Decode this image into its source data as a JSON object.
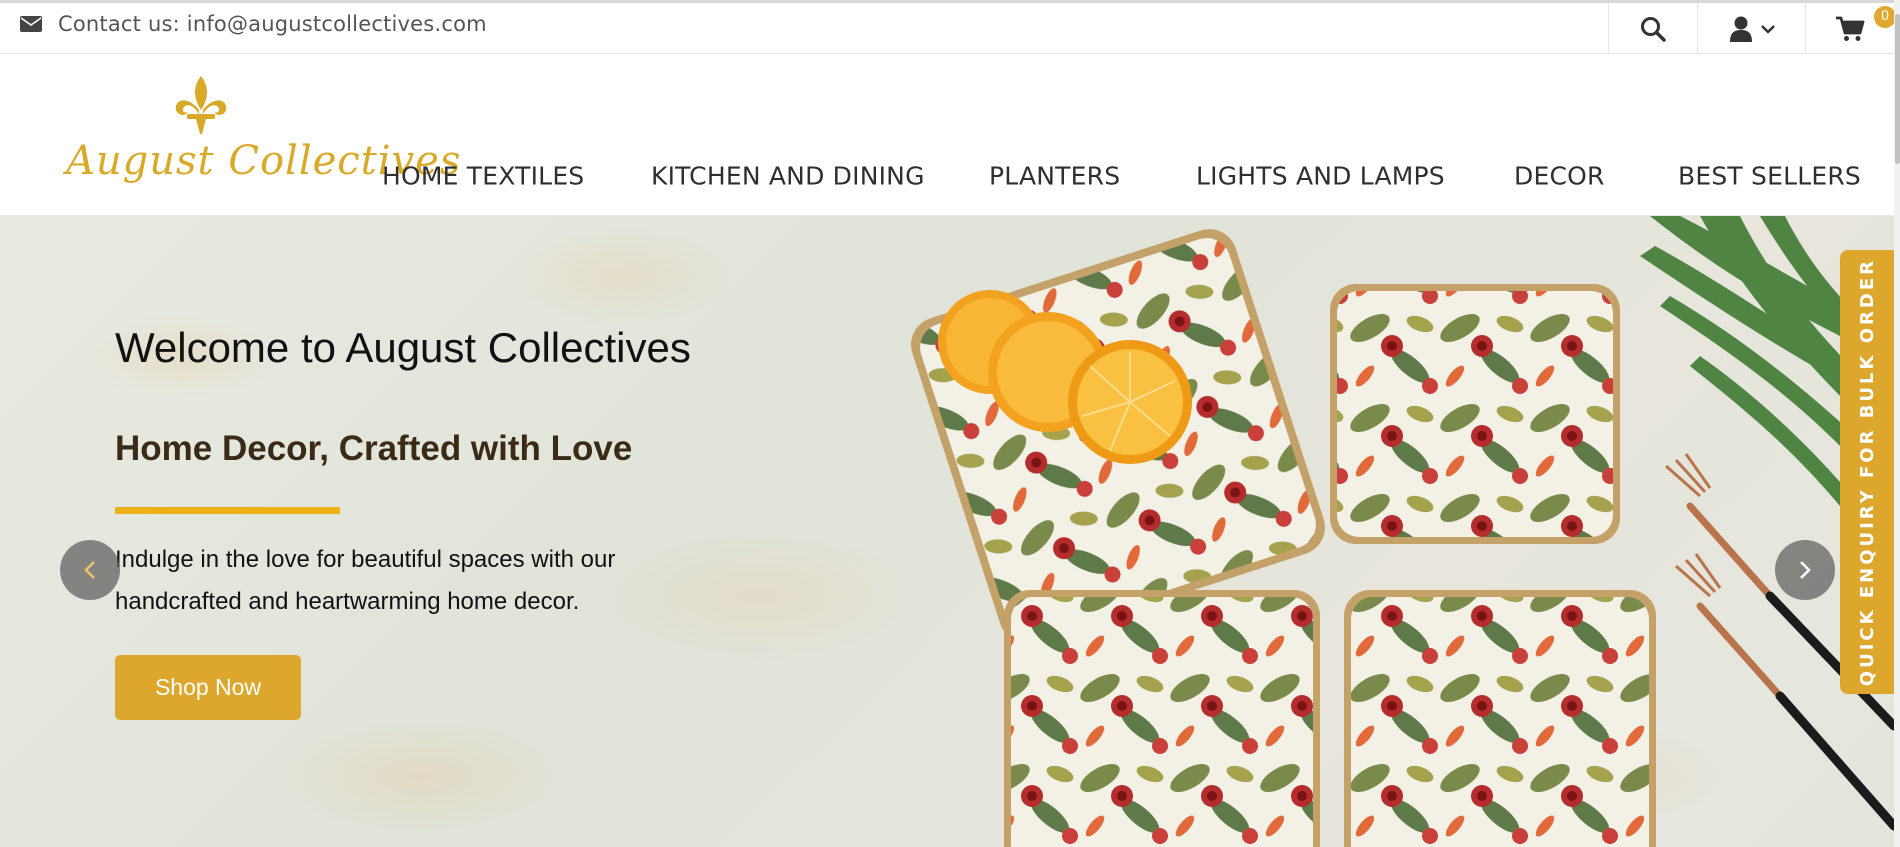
{
  "topbar": {
    "contact_label": "Contact us: info@augustcollectives.com",
    "cart_count": "0",
    "icons": [
      "mail-icon",
      "search-icon",
      "user-icon",
      "chevron-down-icon",
      "cart-icon"
    ]
  },
  "brand": {
    "name": "August Collectives",
    "color": "#d9a928"
  },
  "nav": {
    "items": [
      {
        "label": "HOME TEXTILES"
      },
      {
        "label": "KITCHEN AND DINING"
      },
      {
        "label": "PLANTERS"
      },
      {
        "label": "LIGHTS AND LAMPS"
      },
      {
        "label": "DECOR"
      },
      {
        "label": "BEST SELLERS"
      }
    ]
  },
  "hero": {
    "welcome": "Welcome to August Collectives",
    "tagline": "Home Decor, Crafted with Love",
    "description": "Indulge in the love for beautiful spaces with our handcrafted and heartwarming home decor.",
    "cta_label": "Shop Now",
    "accent_color": "#edb21a",
    "button_color": "#dda72e"
  },
  "side_tab": {
    "label": "QUICK ENQUIRY FOR BULK ORDER"
  }
}
